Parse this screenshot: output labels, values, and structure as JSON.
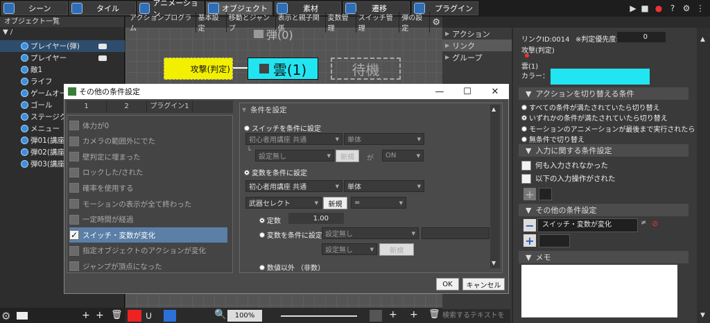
{
  "topbar": {
    "tabs": [
      "シーン",
      "タイル",
      "アニメーション",
      "オブジェクト",
      "素材",
      "遷移",
      "プラグイン"
    ]
  },
  "left_panel": {
    "header": "オブジェクト一覧",
    "root": "/",
    "items": [
      {
        "label": "プレイヤー(弾)",
        "selected": true
      },
      {
        "label": "プレイヤー",
        "selected": false
      },
      {
        "label": "敵1",
        "selected": false
      },
      {
        "label": "ライフ",
        "selected": false
      },
      {
        "label": "ゲームオー",
        "selected": false
      },
      {
        "label": "ゴール",
        "selected": false
      },
      {
        "label": "ステージク",
        "selected": false
      },
      {
        "label": "メニュー",
        "selected": false
      },
      {
        "label": "弾01(講座月",
        "selected": false
      },
      {
        "label": "弾02(講座月",
        "selected": false
      },
      {
        "label": "弾03(講座月",
        "selected": false
      }
    ]
  },
  "canvas": {
    "tabs": [
      "アクションプログラム",
      "基本設定",
      "移動とジャンプ",
      "表示と親子関係",
      "変数管理",
      "スイッチ管理",
      "弾の設定"
    ],
    "nodes": {
      "bullet": "弾(0)",
      "attack": "攻撃(判定)",
      "cloud": "雲(1)",
      "wait": "待機"
    },
    "zoom": "100%"
  },
  "mid_panel": {
    "items": [
      "アクション",
      "リンク",
      "グループ"
    ],
    "search_placeholder": "検索するテキストを"
  },
  "right_panel": {
    "link_id": "リンクID:0014",
    "priority_label": "※判定優先度:",
    "priority_value": "0",
    "from": "攻撃(判定)",
    "to": "雲(1)",
    "color_label": "カラー：",
    "color_value": "#22e5f2",
    "switch_section": "アクションを切り替える条件",
    "switch_options": [
      "すべての条件が満たされていたら切り替え",
      "いずれかの条件が満たされていたら切り替え",
      "モーションのアニメーションが最後まで実行されたら",
      "無条件で切り替え"
    ],
    "input_section": "入力に関する条件設定",
    "input_options": [
      "何も入力されなかった",
      "以下の入力操作がされた"
    ],
    "other_section": "その他の条件設定",
    "other_condition": "スイッチ・変数が変化",
    "memo_section": "メモ"
  },
  "dialog": {
    "title": "その他の条件設定",
    "tabs": [
      "1",
      "2",
      "プラグイン1"
    ],
    "conditions": [
      {
        "label": "体力が0",
        "checked": false,
        "selected": false
      },
      {
        "label": "カメラの範囲外にでた",
        "checked": false,
        "selected": false
      },
      {
        "label": "壁判定に埋まった",
        "checked": false,
        "selected": false
      },
      {
        "label": "ロックした/された",
        "checked": false,
        "selected": false
      },
      {
        "label": "確率を使用する",
        "checked": false,
        "selected": false
      },
      {
        "label": "モーションの表示が全て終わった",
        "checked": false,
        "selected": false
      },
      {
        "label": "一定時間が経過",
        "checked": false,
        "selected": false
      },
      {
        "label": "スイッチ・変数が変化",
        "checked": true,
        "selected": true
      },
      {
        "label": "指定オブジェクトのアクションが変化",
        "checked": false,
        "selected": false
      },
      {
        "label": "ジャンプが頂点になった",
        "checked": false,
        "selected": false
      }
    ],
    "settings": {
      "header": "条件を設定",
      "switch_radio": "スイッチを条件に設定",
      "switch_source": "初心者用講座 共通",
      "switch_scope": "単体",
      "switch_name": "設定無し",
      "new_label": "新規",
      "ga": "が",
      "switch_state": "ON",
      "var_radio": "変数を条件に設定",
      "var_source": "初心者用講座 共通",
      "var_scope": "単体",
      "var_name": "武器セレクト",
      "var_new": "新規",
      "operator": "=",
      "const_radio": "定数",
      "const_value": "1.00",
      "var_cond_radio": "変数を条件に設定",
      "var_cond_name": "設定無し",
      "var_cond_name2": "設定無し",
      "var_cond_new": "新規",
      "not_value_radio": "数値以外 （非数）"
    },
    "ok": "OK",
    "cancel": "キャンセル"
  }
}
